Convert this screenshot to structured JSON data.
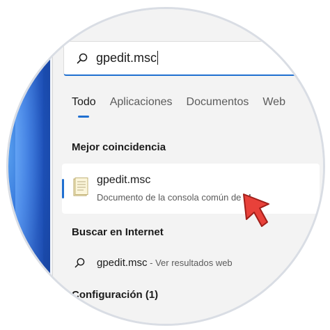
{
  "search": {
    "query": "gpedit.msc",
    "icon": "search-icon"
  },
  "tabs": [
    {
      "label": "Todo",
      "active": true
    },
    {
      "label": "Aplicaciones",
      "active": false
    },
    {
      "label": "Documentos",
      "active": false
    },
    {
      "label": "Web",
      "active": false
    }
  ],
  "best_match": {
    "heading": "Mejor coincidencia",
    "title": "gpedit.msc",
    "subtitle": "Documento de la consola común de M...",
    "icon": "msc-file-icon"
  },
  "internet": {
    "heading": "Buscar en Internet",
    "query": "gpedit.msc",
    "suffix": " - Ver resultados web",
    "chevron": "›"
  },
  "settings": {
    "heading": "Configuración (1)"
  },
  "colors": {
    "accent": "#1f6fd0",
    "pointer": "#e8413a"
  }
}
